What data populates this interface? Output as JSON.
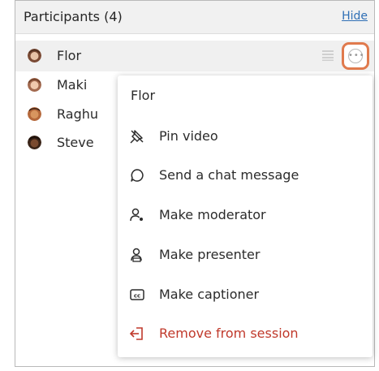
{
  "panel": {
    "title": "Participants (4)",
    "hide_label": "Hide"
  },
  "participants": [
    {
      "name": "Flor",
      "selected": true
    },
    {
      "name": "Maki"
    },
    {
      "name": "Raghu"
    },
    {
      "name": "Steve"
    }
  ],
  "menu": {
    "title": "Flor",
    "items": [
      {
        "label": "Pin video",
        "icon": "pin-icon"
      },
      {
        "label": "Send a chat message",
        "icon": "chat-bubble-icon"
      },
      {
        "label": "Make moderator",
        "icon": "moderator-icon"
      },
      {
        "label": "Make presenter",
        "icon": "presenter-icon"
      },
      {
        "label": "Make captioner",
        "icon": "captions-icon"
      },
      {
        "label": "Remove from session",
        "icon": "remove-exit-icon"
      }
    ]
  },
  "colors": {
    "accent": "#e07a4d",
    "link": "#2f6fb5",
    "danger": "#c0392b"
  }
}
